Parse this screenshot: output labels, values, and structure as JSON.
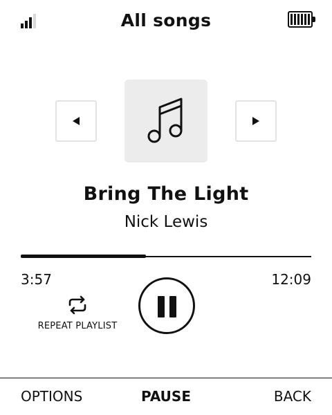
{
  "header": {
    "title": "All songs",
    "signal_icon": "signal-strength-icon",
    "battery_icon": "battery-full-icon"
  },
  "player": {
    "artwork_icon": "music-note-icon",
    "prev_icon": "triangle-left-icon",
    "next_icon": "triangle-right-icon",
    "song_title": "Bring The Light",
    "artist": "Nick Lewis",
    "elapsed": "3:57",
    "total": "12:09",
    "progress_fraction": 0.43,
    "repeat_icon": "repeat-icon",
    "repeat_label": "REPEAT PLAYLIST",
    "pause_icon": "pause-icon"
  },
  "softkeys": {
    "left": "OPTIONS",
    "center": "PAUSE",
    "right": "BACK"
  }
}
